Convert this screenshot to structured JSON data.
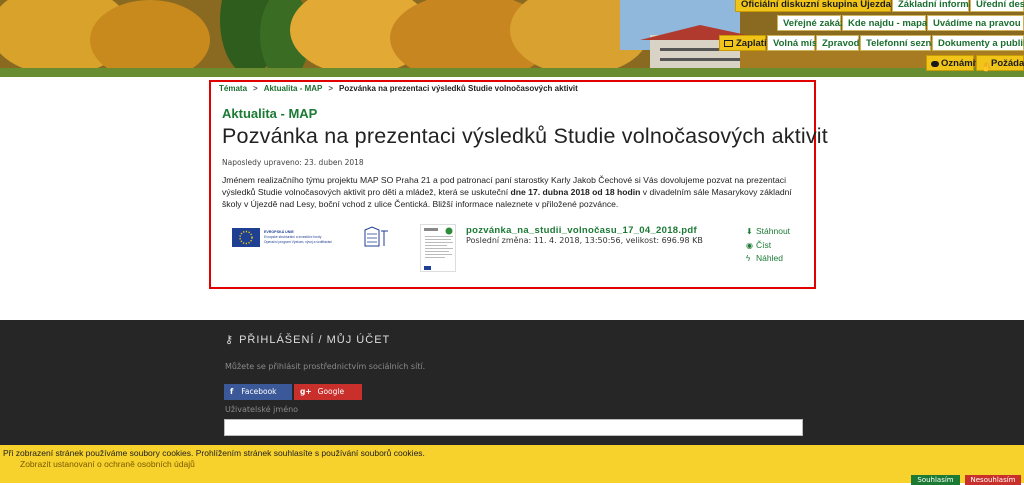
{
  "header": {
    "menu_row1": [
      "Oficiální diskuzní skupina Újezda nad Lesy",
      "Základní informace",
      "Úřední deska"
    ],
    "menu_row2": [
      "Veřejné zakázky",
      "Kde najdu - mapa MČ",
      "Uvádíme na pravou míru"
    ],
    "menu_row3": [
      "Zaplatit",
      "Volná místa",
      "Zpravodaj",
      "Telefonní seznam",
      "Dokumenty a publikace"
    ],
    "menu_row4": [
      "Oznámit",
      "Požádat"
    ]
  },
  "breadcrumb": {
    "items": [
      "Témata",
      "Aktualita - MAP"
    ],
    "current": "Pozvánka na prezentaci výsledků Studie volnočasových aktivit"
  },
  "article": {
    "category": "Aktualita - MAP",
    "title": "Pozvánka na prezentaci výsledků Studie volnočasových aktivit",
    "updated": "Naposledy upraveno: 23. duben 2018",
    "body_pre": "Jménem realizačního týmu projektu MAP SO Praha 21 a pod patronací paní starostky Karly Jakob Čechové si Vás dovolujeme pozvat na prezentaci výsledků Studie volnočasových aktivit pro děti a mládež, která se uskuteční ",
    "body_bold": "dne 17. dubna 2018 od 18 hodin",
    "body_post": " v divadelním sále Masarykovy základní školy v Újezdě nad Lesy, boční vchod z ulice Čentická. Bližší informace naleznete v přiložené pozvánce.",
    "eu_logo_text": [
      "EVROPSKÁ UNIE",
      "Evropské strukturální a investiční fondy",
      "Operační program Výzkum, vývoj a vzdělávání"
    ],
    "attachment": {
      "filename": "pozvánka_na_studii_volnočasu_17_04_2018.pdf",
      "meta": "Poslední změna: 11. 4. 2018, 13:50:56, velikost: 696.98 KB",
      "actions": [
        "Stáhnout",
        "Číst",
        "Náhled"
      ]
    }
  },
  "footer": {
    "login_title": "PŘIHLÁŠENÍ / MŮJ ÚČET",
    "login_sub": "Můžete se přihlásit prostřednictvím sociálních sítí.",
    "facebook_label": "Facebook",
    "google_label": "Google",
    "username_label": "Uživatelské jméno"
  },
  "cookie": {
    "text": "Při zobrazení stránek používáme soubory cookies. Prohlížením stránek souhlasíte s používání souborů cookies.",
    "link": "Zobrazit ustanovaní o ochraně osobních údajů",
    "agree": "Souhlasím",
    "refuse": "Nesouhlasím"
  },
  "colors": {
    "accent_green": "#1b7a34",
    "menu_yellow": "#f0c419",
    "highlight_red": "#e00000",
    "footer_dark": "#262626",
    "cookie_yellow": "#f7d12c"
  }
}
